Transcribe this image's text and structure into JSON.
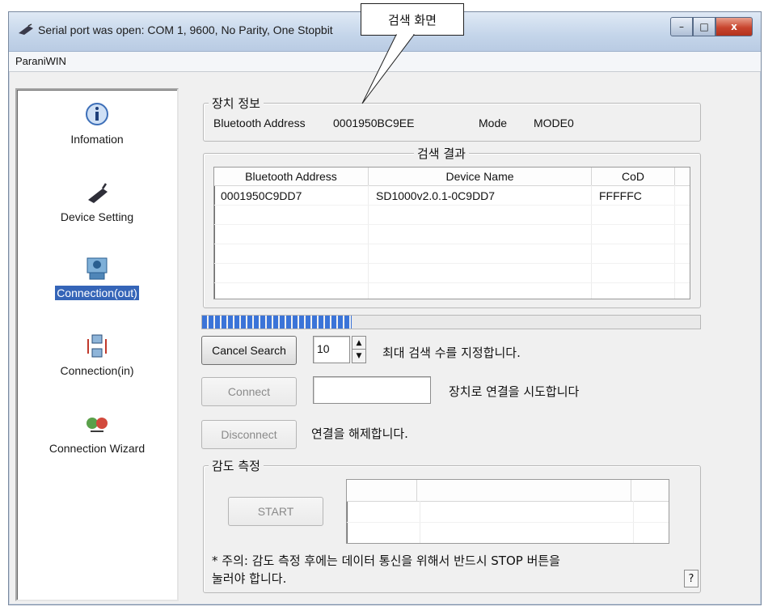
{
  "window": {
    "title": "Serial port was open: COM 1, 9600, No Parity, One Stopbit",
    "menu": "ParaniWIN",
    "controls": {
      "minimize": "–",
      "maximize": "□",
      "close": "x"
    }
  },
  "callout": {
    "text": "검색 화면"
  },
  "sidebar": {
    "items": [
      {
        "label": "Infomation",
        "icon": "info-icon"
      },
      {
        "label": "Device Setting",
        "icon": "device-setting-icon"
      },
      {
        "label": "Connection(out)",
        "icon": "connection-out-icon",
        "selected": true
      },
      {
        "label": "Connection(in)",
        "icon": "connection-in-icon"
      },
      {
        "label": "Connection Wizard",
        "icon": "connection-wizard-icon"
      }
    ]
  },
  "device_info": {
    "title": "장치 정보",
    "address_label": "Bluetooth Address",
    "address_value": "0001950BC9EE",
    "mode_label": "Mode",
    "mode_value": "MODE0"
  },
  "search_result": {
    "title": "검색 결과",
    "columns": [
      "Bluetooth Address",
      "Device Name",
      "CoD"
    ],
    "rows": [
      [
        "0001950C9DD7",
        "SD1000v2.0.1-0C9DD7",
        "FFFFFC"
      ]
    ]
  },
  "progress": {
    "fraction": 0.3
  },
  "controls": {
    "cancel_search": "Cancel Search",
    "max_count_value": "10",
    "max_count_desc": "최대 검색 수를 지정합니다.",
    "connect": "Connect",
    "connect_desc": "장치로 연결을 시도합니다",
    "disconnect": "Disconnect",
    "disconnect_desc": "연결을 해제합니다."
  },
  "sensitivity": {
    "title": "감도 측정",
    "start": "START",
    "note_line1": "* 주의: 감도 측정 후에는 데이터 통신을 위해서 반드시 STOP 버튼을",
    "note_line2": "눌러야 합니다.",
    "help": "?"
  }
}
